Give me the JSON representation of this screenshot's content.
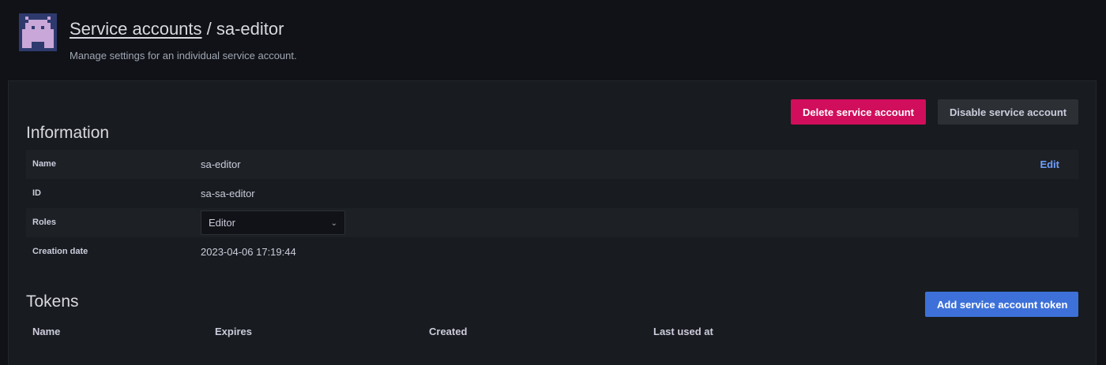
{
  "header": {
    "breadcrumb_link": "Service accounts",
    "separator": " / ",
    "current": "sa-editor",
    "subtitle": "Manage settings for an individual service account.",
    "avatar_icon": "identicon-avatar"
  },
  "actions": {
    "delete_label": "Delete service account",
    "disable_label": "Disable service account"
  },
  "information": {
    "title": "Information",
    "rows": [
      {
        "label": "Name",
        "value": "sa-editor",
        "action": "Edit"
      },
      {
        "label": "ID",
        "value": "sa-sa-editor"
      },
      {
        "label": "Roles",
        "value": "Editor"
      },
      {
        "label": "Creation date",
        "value": "2023-04-06 17:19:44"
      }
    ]
  },
  "tokens": {
    "title": "Tokens",
    "add_label": "Add service account token",
    "columns": [
      "Name",
      "Expires",
      "Created",
      "Last used at"
    ]
  },
  "colors": {
    "danger": "#d10e5c",
    "primary": "#3d71d9",
    "link": "#6e9fff",
    "background": "#111217",
    "panel": "#181b1f"
  }
}
